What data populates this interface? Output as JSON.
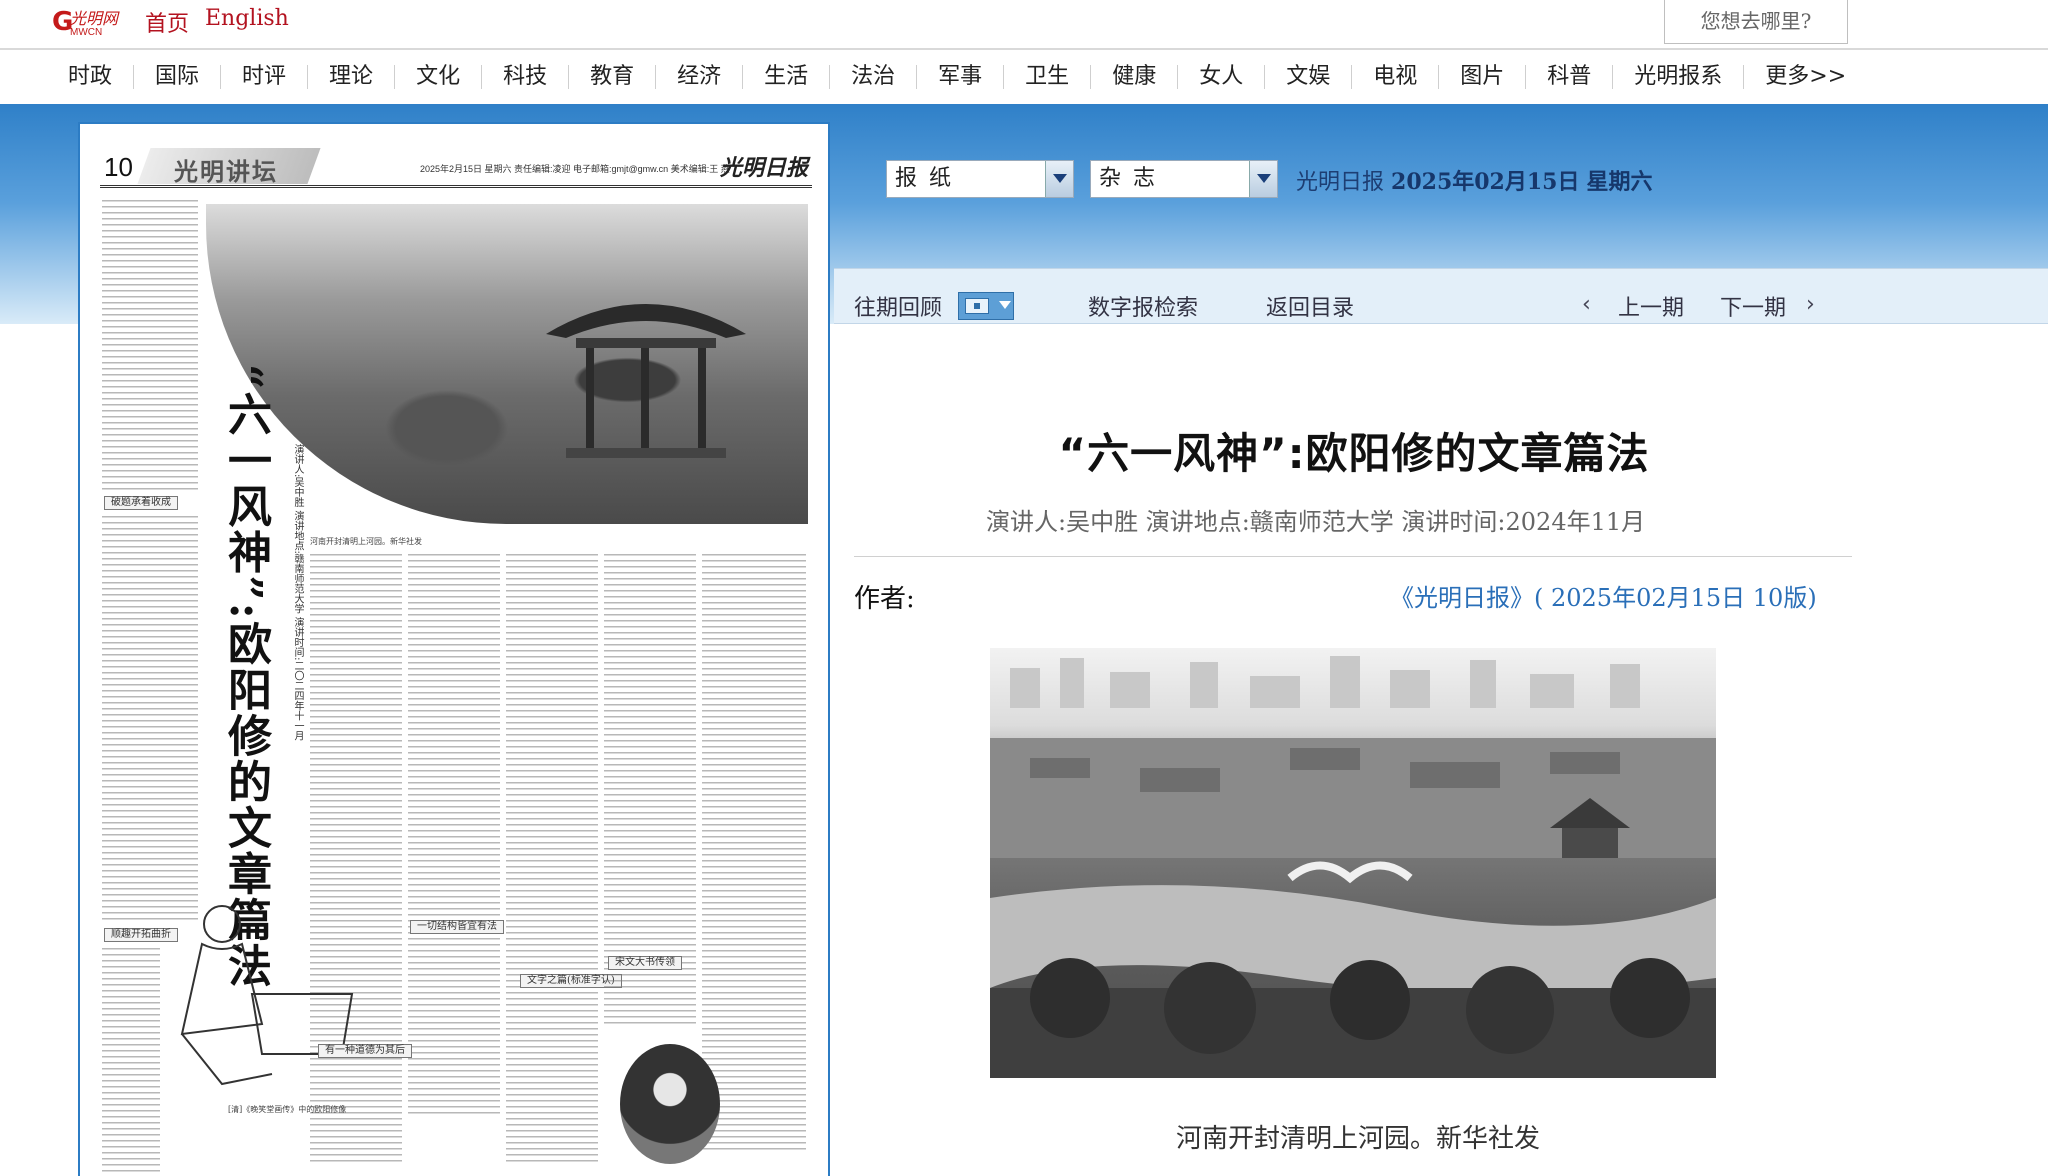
{
  "topbar": {
    "logo_text": "光明网",
    "links": [
      "首页",
      "English"
    ],
    "search_placeholder": "您想去哪里?"
  },
  "nav": {
    "items": [
      "时政",
      "国际",
      "时评",
      "理论",
      "文化",
      "科技",
      "教育",
      "经济",
      "生活",
      "法治",
      "军事",
      "卫生",
      "健康",
      "女人",
      "文娱",
      "电视",
      "图片",
      "科普",
      "光明报系",
      "更多>>"
    ]
  },
  "paper_page": {
    "page_number": "10",
    "section": "光明讲坛",
    "date_line": "2025年2月15日  星期六  责任编辑:凌迎  电子邮箱:gmjt@gmw.cn  美术编辑:王  燕",
    "brand": "光明日报",
    "headline": "“六一风神”:欧阳修的文章篇法",
    "speaker_vertical": "演讲人:吴中胜  演讲地点:赣南师范大学  演讲时间:二〇二四年十一月",
    "section_tags": [
      "破题承着收成",
      "顺趣开拓曲折",
      "有一种道德为其后",
      "一切结构皆宜有法",
      "文字之篇(标准字认)",
      "宋文大书传领"
    ],
    "photo_caption": "河南开封清明上河园。新华社发",
    "sketch_caption": "[清]《晚笑堂画传》中的欧阳修像"
  },
  "controls": {
    "paper_select": "报纸",
    "magazine_select": "杂志",
    "paper_name": "光明日报",
    "issue_date": "2025年02月15日",
    "weekday": "星期六"
  },
  "toolbar": {
    "archive": "往期回顾",
    "search": "数字报检索",
    "back": "返回目录",
    "prev": "上一期",
    "next": "下一期"
  },
  "article": {
    "title": "“六一风神”:欧阳修的文章篇法",
    "subtitle": "演讲人:吴中胜  演讲地点:赣南师范大学  演讲时间:2024年11月",
    "author_label": "作者:",
    "source": "《光明日报》( 2025年02月15日  10版)",
    "photo_caption": "河南开封清明上河园。新华社发"
  }
}
